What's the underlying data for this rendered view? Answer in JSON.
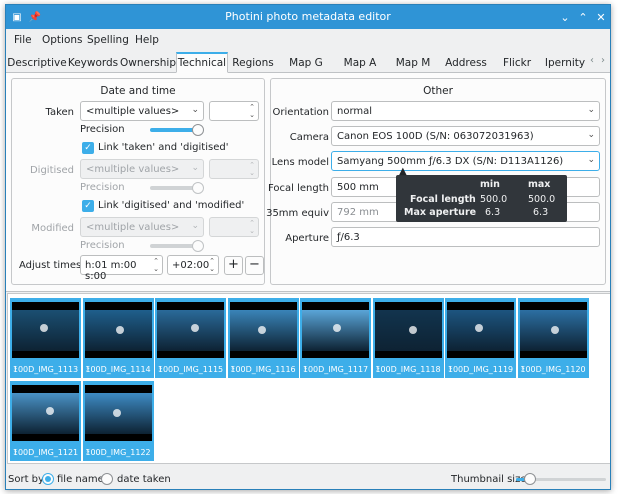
{
  "window": {
    "title": "Photini photo metadata editor",
    "pin_icon": "pin-icon"
  },
  "menu": [
    "File",
    "Options",
    "Spelling",
    "Help"
  ],
  "tabs": [
    "Descriptive",
    "Keywords",
    "Ownership",
    "Technical",
    "Regions",
    "Map G",
    "Map A",
    "Map M",
    "Address",
    "Flickr",
    "Ipernity"
  ],
  "active_tab": "Technical",
  "date_time": {
    "title": "Date and time",
    "taken_label": "Taken",
    "taken_value": "<multiple values>",
    "precision_label": "Precision",
    "link_taken_digitised": "Link 'taken' and 'digitised'",
    "digitised_label": "Digitised",
    "digitised_value": "<multiple values>",
    "link_digitised_modified": "Link 'digitised' and 'modified'",
    "modified_label": "Modified",
    "modified_value": "<multiple values>",
    "adjust_label": "Adjust times",
    "adjust_value": "h:01 m:00 s:00",
    "tz_value": "+02:00",
    "plus": "+",
    "minus": "−"
  },
  "other": {
    "title": "Other",
    "orientation_label": "Orientation",
    "orientation_value": "normal",
    "camera_label": "Camera",
    "camera_value": "Canon EOS 100D (S/N: 063072031963)",
    "lens_label": "Lens model",
    "lens_value": "Samyang 500mm ƒ/6.3 DX (S/N: D113A1126)",
    "focal_label": "Focal length",
    "focal_value": "500 mm",
    "equiv_label": "35mm equiv",
    "equiv_value": "792 mm",
    "aperture_label": "Aperture",
    "aperture_value": "ƒ/6.3"
  },
  "tooltip": {
    "col_min": "min",
    "col_max": "max",
    "row1_label": "Focal length",
    "row1_min": "500.0",
    "row1_max": "500.0",
    "row2_label": "Max aperture",
    "row2_min": "6.3",
    "row2_max": "6.3"
  },
  "thumbnails": [
    {
      "name": "100D_IMG_1113",
      "tone": "#1b4f72"
    },
    {
      "name": "100D_IMG_1114",
      "tone": "#1f5f8c"
    },
    {
      "name": "100D_IMG_1115",
      "tone": "#2a6a99"
    },
    {
      "name": "100D_IMG_1116",
      "tone": "#3a84b8"
    },
    {
      "name": "100D_IMG_1117",
      "tone": "#5aa5d8"
    },
    {
      "name": "100D_IMG_1118",
      "tone": "#12344e"
    },
    {
      "name": "100D_IMG_1119",
      "tone": "#1d5580"
    },
    {
      "name": "100D_IMG_1120",
      "tone": "#2c6fa2"
    },
    {
      "name": "100D_IMG_1121",
      "tone": "#4a92c6"
    },
    {
      "name": "100D_IMG_1122",
      "tone": "#3e8bc4"
    }
  ],
  "bottom": {
    "sort_label": "Sort by",
    "opt_filename": "file name",
    "opt_date": "date taken",
    "thumb_size_label": "Thumbnail size",
    "thumb_size_level": 0.1
  },
  "colors": {
    "accent": "#3daee9",
    "titlebar": "#2f94d6"
  }
}
